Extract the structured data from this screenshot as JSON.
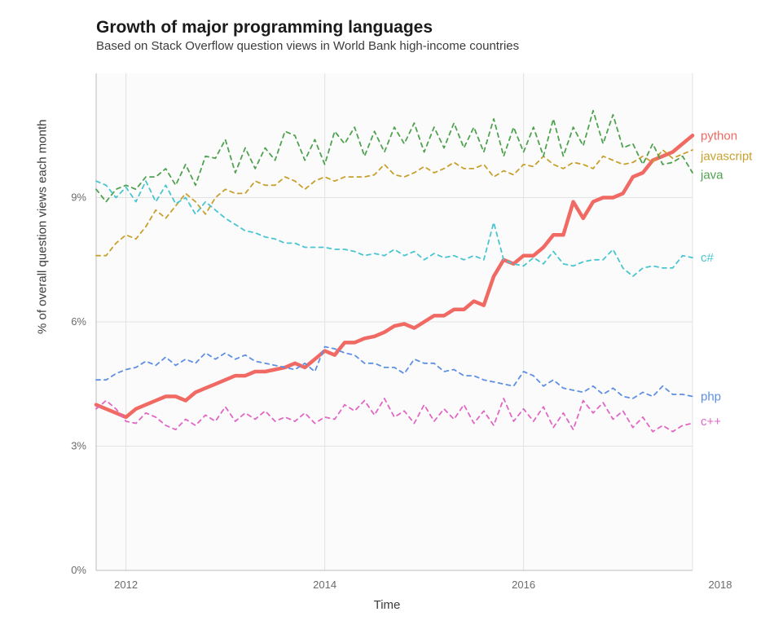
{
  "chart_data": {
    "type": "line",
    "title": "Growth of major programming languages",
    "subtitle": "Based on Stack Overflow question views in World Bank high-income countries",
    "xlabel": "Time",
    "ylabel": "% of overall question views each month",
    "xlim": [
      2011.7,
      2017.7
    ],
    "ylim": [
      0,
      12
    ],
    "x_ticks": [
      2012,
      2014,
      2016,
      2018
    ],
    "y_ticks": [
      "0%",
      "3%",
      "6%",
      "9%"
    ],
    "y_tick_vals": [
      0,
      3,
      6,
      9
    ],
    "x": [
      2011.7,
      2011.8,
      2011.9,
      2012.0,
      2012.1,
      2012.2,
      2012.3,
      2012.4,
      2012.5,
      2012.6,
      2012.7,
      2012.8,
      2012.9,
      2013.0,
      2013.1,
      2013.2,
      2013.3,
      2013.4,
      2013.5,
      2013.6,
      2013.7,
      2013.8,
      2013.9,
      2014.0,
      2014.1,
      2014.2,
      2014.3,
      2014.4,
      2014.5,
      2014.6,
      2014.7,
      2014.8,
      2014.9,
      2015.0,
      2015.1,
      2015.2,
      2015.3,
      2015.4,
      2015.5,
      2015.6,
      2015.7,
      2015.8,
      2015.9,
      2016.0,
      2016.1,
      2016.2,
      2016.3,
      2016.4,
      2016.5,
      2016.6,
      2016.7,
      2016.8,
      2016.9,
      2017.0,
      2017.1,
      2017.2,
      2017.3,
      2017.4,
      2017.5,
      2017.6,
      2017.7
    ],
    "series": [
      {
        "name": "python",
        "color": "#F16963",
        "dashed": false,
        "thick": true,
        "label_y": 10.5,
        "values": [
          4.0,
          3.9,
          3.8,
          3.7,
          3.9,
          4.0,
          4.1,
          4.2,
          4.2,
          4.1,
          4.3,
          4.4,
          4.5,
          4.6,
          4.7,
          4.7,
          4.8,
          4.8,
          4.85,
          4.9,
          5.0,
          4.9,
          5.1,
          5.3,
          5.2,
          5.5,
          5.5,
          5.6,
          5.65,
          5.75,
          5.9,
          5.95,
          5.85,
          6.0,
          6.15,
          6.15,
          6.3,
          6.3,
          6.5,
          6.4,
          7.1,
          7.5,
          7.4,
          7.6,
          7.6,
          7.8,
          8.1,
          8.1,
          8.9,
          8.5,
          8.9,
          9.0,
          9.0,
          9.1,
          9.5,
          9.6,
          9.9,
          10.0,
          10.1,
          10.3,
          10.5
        ]
      },
      {
        "name": "javascript",
        "color": "#C8A02E",
        "dashed": true,
        "thick": false,
        "label_y": 10.0,
        "values": [
          7.6,
          7.6,
          7.9,
          8.1,
          8.0,
          8.3,
          8.7,
          8.5,
          8.8,
          9.1,
          8.9,
          8.6,
          9.0,
          9.2,
          9.1,
          9.1,
          9.4,
          9.3,
          9.3,
          9.5,
          9.4,
          9.2,
          9.4,
          9.5,
          9.4,
          9.5,
          9.5,
          9.5,
          9.55,
          9.8,
          9.55,
          9.5,
          9.6,
          9.75,
          9.6,
          9.7,
          9.85,
          9.7,
          9.7,
          9.8,
          9.5,
          9.65,
          9.55,
          9.8,
          9.75,
          10.0,
          9.8,
          9.7,
          9.85,
          9.8,
          9.7,
          10.0,
          9.9,
          9.8,
          9.85,
          10.0,
          9.85,
          10.15,
          9.95,
          10.05,
          10.15
        ]
      },
      {
        "name": "java",
        "color": "#4FA24F",
        "dashed": true,
        "thick": false,
        "label_y": 9.55,
        "values": [
          9.2,
          8.9,
          9.2,
          9.3,
          9.2,
          9.5,
          9.5,
          9.7,
          9.3,
          9.8,
          9.3,
          10.0,
          9.95,
          10.4,
          9.6,
          10.2,
          9.7,
          10.2,
          9.9,
          10.6,
          10.5,
          9.9,
          10.4,
          9.8,
          10.6,
          10.3,
          10.7,
          10.0,
          10.6,
          10.1,
          10.7,
          10.3,
          10.8,
          10.1,
          10.7,
          10.2,
          10.8,
          10.2,
          10.7,
          10.1,
          10.9,
          10.0,
          10.7,
          10.1,
          10.7,
          10.0,
          10.9,
          10.0,
          10.7,
          10.25,
          11.1,
          10.3,
          11.0,
          10.2,
          10.3,
          9.8,
          10.3,
          9.8,
          9.85,
          10.0,
          9.6
        ]
      },
      {
        "name": "c#",
        "color": "#49C5D1",
        "dashed": true,
        "thick": false,
        "label_y": 7.55,
        "values": [
          9.4,
          9.3,
          9.0,
          9.25,
          8.9,
          9.4,
          8.9,
          9.3,
          8.85,
          9.0,
          8.6,
          8.9,
          8.7,
          8.5,
          8.35,
          8.2,
          8.15,
          8.05,
          8.0,
          7.9,
          7.9,
          7.8,
          7.8,
          7.8,
          7.75,
          7.75,
          7.7,
          7.6,
          7.65,
          7.6,
          7.75,
          7.6,
          7.7,
          7.5,
          7.65,
          7.55,
          7.6,
          7.5,
          7.6,
          7.5,
          8.4,
          7.5,
          7.4,
          7.35,
          7.55,
          7.4,
          7.7,
          7.4,
          7.35,
          7.45,
          7.5,
          7.5,
          7.75,
          7.3,
          7.1,
          7.3,
          7.35,
          7.3,
          7.3,
          7.6,
          7.55
        ]
      },
      {
        "name": "php",
        "color": "#5E8FE2",
        "dashed": true,
        "thick": false,
        "label_y": 4.2,
        "values": [
          4.6,
          4.6,
          4.75,
          4.85,
          4.9,
          5.05,
          4.95,
          5.15,
          4.95,
          5.1,
          5.0,
          5.25,
          5.1,
          5.25,
          5.1,
          5.2,
          5.05,
          5.0,
          4.95,
          4.9,
          4.85,
          5.0,
          4.8,
          5.4,
          5.35,
          5.25,
          5.2,
          5.0,
          5.0,
          4.9,
          4.9,
          4.75,
          5.1,
          5.0,
          5.0,
          4.8,
          4.85,
          4.7,
          4.7,
          4.6,
          4.55,
          4.5,
          4.45,
          4.8,
          4.7,
          4.45,
          4.6,
          4.4,
          4.35,
          4.3,
          4.45,
          4.25,
          4.4,
          4.2,
          4.15,
          4.3,
          4.2,
          4.45,
          4.25,
          4.25,
          4.2
        ]
      },
      {
        "name": "c++",
        "color": "#E067C5",
        "dashed": true,
        "thick": false,
        "label_y": 3.6,
        "values": [
          3.9,
          4.1,
          3.9,
          3.6,
          3.55,
          3.8,
          3.7,
          3.5,
          3.4,
          3.65,
          3.5,
          3.75,
          3.6,
          3.95,
          3.6,
          3.8,
          3.65,
          3.85,
          3.6,
          3.7,
          3.6,
          3.8,
          3.55,
          3.7,
          3.65,
          4.0,
          3.85,
          4.1,
          3.75,
          4.15,
          3.7,
          3.85,
          3.55,
          4.0,
          3.6,
          3.9,
          3.65,
          4.0,
          3.55,
          3.85,
          3.5,
          4.15,
          3.6,
          3.9,
          3.6,
          3.95,
          3.45,
          3.8,
          3.4,
          4.1,
          3.8,
          4.05,
          3.65,
          3.85,
          3.45,
          3.7,
          3.35,
          3.5,
          3.35,
          3.5,
          3.55
        ]
      }
    ],
    "label_order": [
      "python",
      "javascript",
      "java",
      "c#",
      "php",
      "c++"
    ]
  }
}
